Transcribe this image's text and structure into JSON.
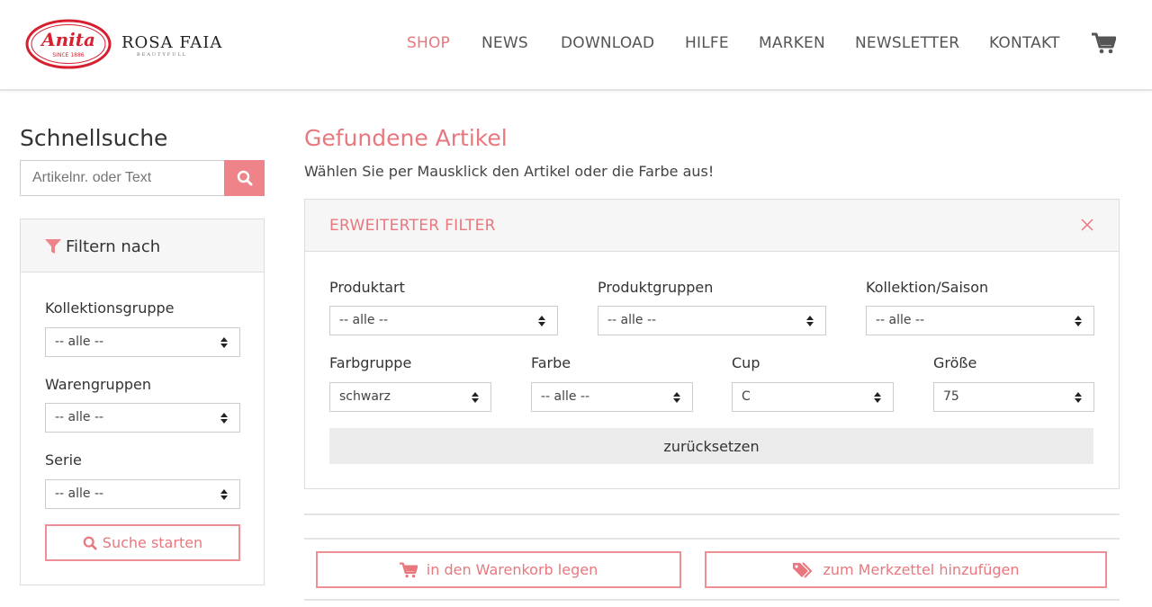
{
  "header": {
    "logo_text": "Anita",
    "logo_since": "SINCE 1886",
    "brand_name": "ROSA FAIA",
    "brand_sub": "BEAUTYFULL",
    "nav": [
      {
        "label": "SHOP",
        "active": true
      },
      {
        "label": "NEWS",
        "active": false
      },
      {
        "label": "DOWNLOAD",
        "active": false
      },
      {
        "label": "HILFE",
        "active": false
      },
      {
        "label": "MARKEN",
        "active": false
      },
      {
        "label": "NEWSLETTER",
        "active": false
      },
      {
        "label": "KONTAKT",
        "active": false
      }
    ],
    "cart_icon": "shopping-cart-icon"
  },
  "sidebar": {
    "title": "Schnellsuche",
    "search_placeholder": "Artikelnr. oder Text",
    "search_icon": "search-icon",
    "filter_title": "Filtern nach",
    "filter_icon": "funnel-icon",
    "fields": [
      {
        "label": "Kollektionsgruppe",
        "value": "-- alle --"
      },
      {
        "label": "Warengruppen",
        "value": "-- alle --"
      },
      {
        "label": "Serie",
        "value": "-- alle --"
      }
    ],
    "search_button": "Suche starten"
  },
  "main": {
    "title": "Gefundene Artikel",
    "subtitle": "Wählen Sie per Mausklick den Artikel oder die Farbe aus!",
    "adv_filter": {
      "title": "ERWEITERTER FILTER",
      "row1": [
        {
          "label": "Produktart",
          "value": "-- alle --"
        },
        {
          "label": "Produktgruppen",
          "value": "-- alle --"
        },
        {
          "label": "Kollektion/Saison",
          "value": "-- alle --"
        }
      ],
      "row2": [
        {
          "label": "Farbgruppe",
          "value": "schwarz"
        },
        {
          "label": "Farbe",
          "value": "-- alle --"
        },
        {
          "label": "Cup",
          "value": "C"
        },
        {
          "label": "Größe",
          "value": "75"
        }
      ],
      "reset_label": "zurücksetzen"
    },
    "cart_button": "in den Warenkorb legen",
    "wishlist_button": "zum Merkzettel hinzufügen"
  },
  "colors": {
    "accent": "#e9777e",
    "accent_button": "#ee8389",
    "panel_bg": "#f6f6f6",
    "border": "#dddddd",
    "logo_red": "#d6202f"
  }
}
